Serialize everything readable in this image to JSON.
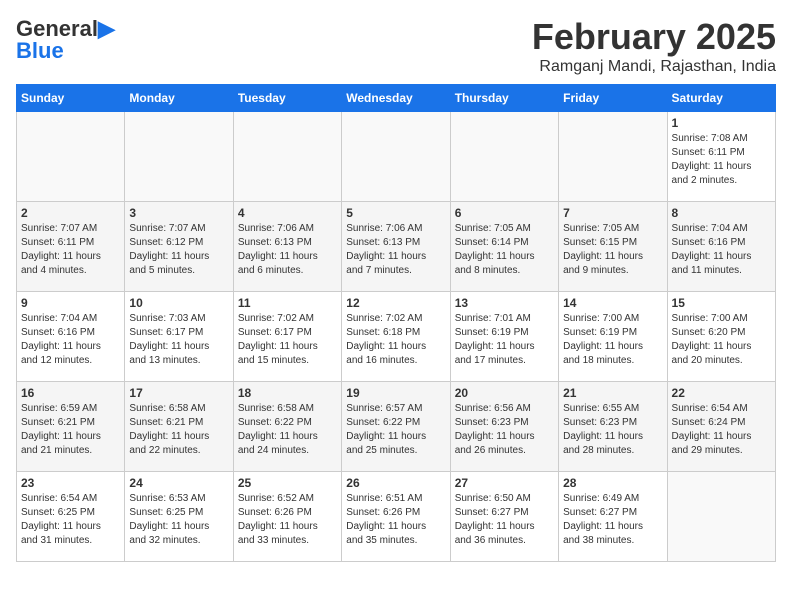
{
  "header": {
    "logo_general": "General",
    "logo_blue": "Blue",
    "title": "February 2025",
    "subtitle": "Ramganj Mandi, Rajasthan, India"
  },
  "days_of_week": [
    "Sunday",
    "Monday",
    "Tuesday",
    "Wednesday",
    "Thursday",
    "Friday",
    "Saturday"
  ],
  "weeks": [
    [
      {
        "day": "",
        "info": ""
      },
      {
        "day": "",
        "info": ""
      },
      {
        "day": "",
        "info": ""
      },
      {
        "day": "",
        "info": ""
      },
      {
        "day": "",
        "info": ""
      },
      {
        "day": "",
        "info": ""
      },
      {
        "day": "1",
        "info": "Sunrise: 7:08 AM\nSunset: 6:11 PM\nDaylight: 11 hours\nand 2 minutes."
      }
    ],
    [
      {
        "day": "2",
        "info": "Sunrise: 7:07 AM\nSunset: 6:11 PM\nDaylight: 11 hours\nand 4 minutes."
      },
      {
        "day": "3",
        "info": "Sunrise: 7:07 AM\nSunset: 6:12 PM\nDaylight: 11 hours\nand 5 minutes."
      },
      {
        "day": "4",
        "info": "Sunrise: 7:06 AM\nSunset: 6:13 PM\nDaylight: 11 hours\nand 6 minutes."
      },
      {
        "day": "5",
        "info": "Sunrise: 7:06 AM\nSunset: 6:13 PM\nDaylight: 11 hours\nand 7 minutes."
      },
      {
        "day": "6",
        "info": "Sunrise: 7:05 AM\nSunset: 6:14 PM\nDaylight: 11 hours\nand 8 minutes."
      },
      {
        "day": "7",
        "info": "Sunrise: 7:05 AM\nSunset: 6:15 PM\nDaylight: 11 hours\nand 9 minutes."
      },
      {
        "day": "8",
        "info": "Sunrise: 7:04 AM\nSunset: 6:16 PM\nDaylight: 11 hours\nand 11 minutes."
      }
    ],
    [
      {
        "day": "9",
        "info": "Sunrise: 7:04 AM\nSunset: 6:16 PM\nDaylight: 11 hours\nand 12 minutes."
      },
      {
        "day": "10",
        "info": "Sunrise: 7:03 AM\nSunset: 6:17 PM\nDaylight: 11 hours\nand 13 minutes."
      },
      {
        "day": "11",
        "info": "Sunrise: 7:02 AM\nSunset: 6:17 PM\nDaylight: 11 hours\nand 15 minutes."
      },
      {
        "day": "12",
        "info": "Sunrise: 7:02 AM\nSunset: 6:18 PM\nDaylight: 11 hours\nand 16 minutes."
      },
      {
        "day": "13",
        "info": "Sunrise: 7:01 AM\nSunset: 6:19 PM\nDaylight: 11 hours\nand 17 minutes."
      },
      {
        "day": "14",
        "info": "Sunrise: 7:00 AM\nSunset: 6:19 PM\nDaylight: 11 hours\nand 18 minutes."
      },
      {
        "day": "15",
        "info": "Sunrise: 7:00 AM\nSunset: 6:20 PM\nDaylight: 11 hours\nand 20 minutes."
      }
    ],
    [
      {
        "day": "16",
        "info": "Sunrise: 6:59 AM\nSunset: 6:21 PM\nDaylight: 11 hours\nand 21 minutes."
      },
      {
        "day": "17",
        "info": "Sunrise: 6:58 AM\nSunset: 6:21 PM\nDaylight: 11 hours\nand 22 minutes."
      },
      {
        "day": "18",
        "info": "Sunrise: 6:58 AM\nSunset: 6:22 PM\nDaylight: 11 hours\nand 24 minutes."
      },
      {
        "day": "19",
        "info": "Sunrise: 6:57 AM\nSunset: 6:22 PM\nDaylight: 11 hours\nand 25 minutes."
      },
      {
        "day": "20",
        "info": "Sunrise: 6:56 AM\nSunset: 6:23 PM\nDaylight: 11 hours\nand 26 minutes."
      },
      {
        "day": "21",
        "info": "Sunrise: 6:55 AM\nSunset: 6:23 PM\nDaylight: 11 hours\nand 28 minutes."
      },
      {
        "day": "22",
        "info": "Sunrise: 6:54 AM\nSunset: 6:24 PM\nDaylight: 11 hours\nand 29 minutes."
      }
    ],
    [
      {
        "day": "23",
        "info": "Sunrise: 6:54 AM\nSunset: 6:25 PM\nDaylight: 11 hours\nand 31 minutes."
      },
      {
        "day": "24",
        "info": "Sunrise: 6:53 AM\nSunset: 6:25 PM\nDaylight: 11 hours\nand 32 minutes."
      },
      {
        "day": "25",
        "info": "Sunrise: 6:52 AM\nSunset: 6:26 PM\nDaylight: 11 hours\nand 33 minutes."
      },
      {
        "day": "26",
        "info": "Sunrise: 6:51 AM\nSunset: 6:26 PM\nDaylight: 11 hours\nand 35 minutes."
      },
      {
        "day": "27",
        "info": "Sunrise: 6:50 AM\nSunset: 6:27 PM\nDaylight: 11 hours\nand 36 minutes."
      },
      {
        "day": "28",
        "info": "Sunrise: 6:49 AM\nSunset: 6:27 PM\nDaylight: 11 hours\nand 38 minutes."
      },
      {
        "day": "",
        "info": ""
      }
    ]
  ]
}
